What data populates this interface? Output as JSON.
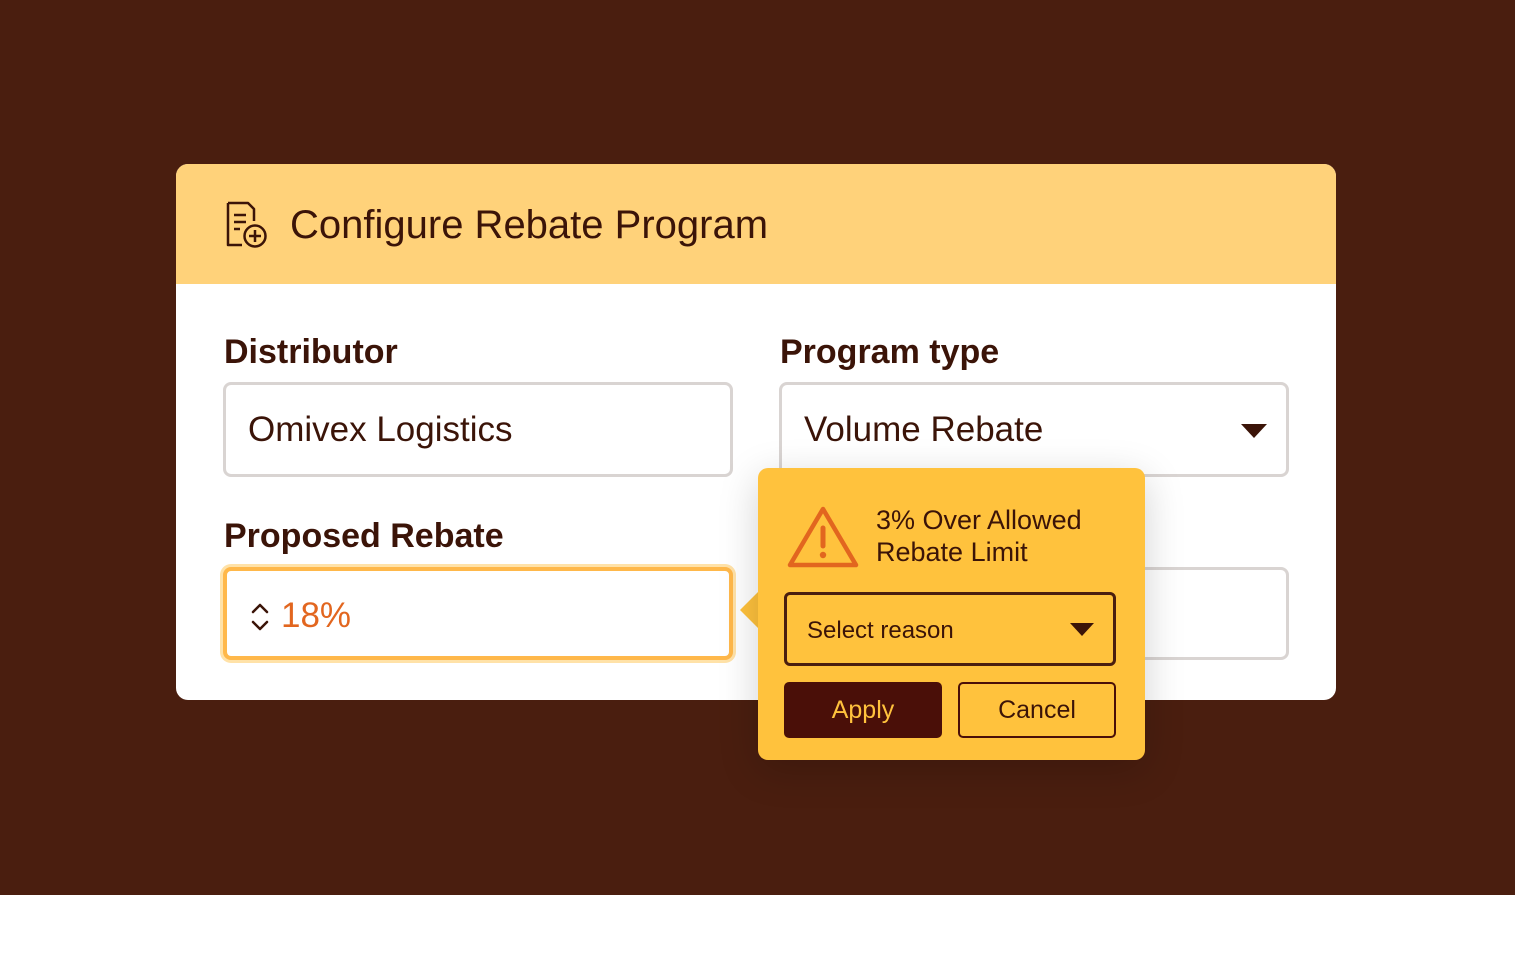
{
  "dialog": {
    "title": "Configure Rebate Program",
    "title_icon": "document-add-icon"
  },
  "fields": {
    "distributor": {
      "label": "Distributor",
      "value": "Omivex Logistics"
    },
    "program_type": {
      "label": "Program type",
      "value": "Volume Rebate",
      "icon": "chevron-down-icon"
    },
    "proposed_rebate": {
      "label": "Proposed Rebate",
      "value": "18%",
      "icon": "stepper-icon"
    }
  },
  "warning_popover": {
    "icon": "warning-triangle-icon",
    "message_line1": "3% Over Allowed",
    "message_line2": "Rebate Limit",
    "reason_select": {
      "value": "Select reason",
      "icon": "chevron-down-icon"
    },
    "apply_label": "Apply",
    "cancel_label": "Cancel"
  },
  "colors": {
    "backdrop": "#4a1e0f",
    "header": "#ffd27a",
    "popover": "#ffc23d",
    "accent_text": "#e2661f",
    "primary_button": "#4a0f08"
  }
}
